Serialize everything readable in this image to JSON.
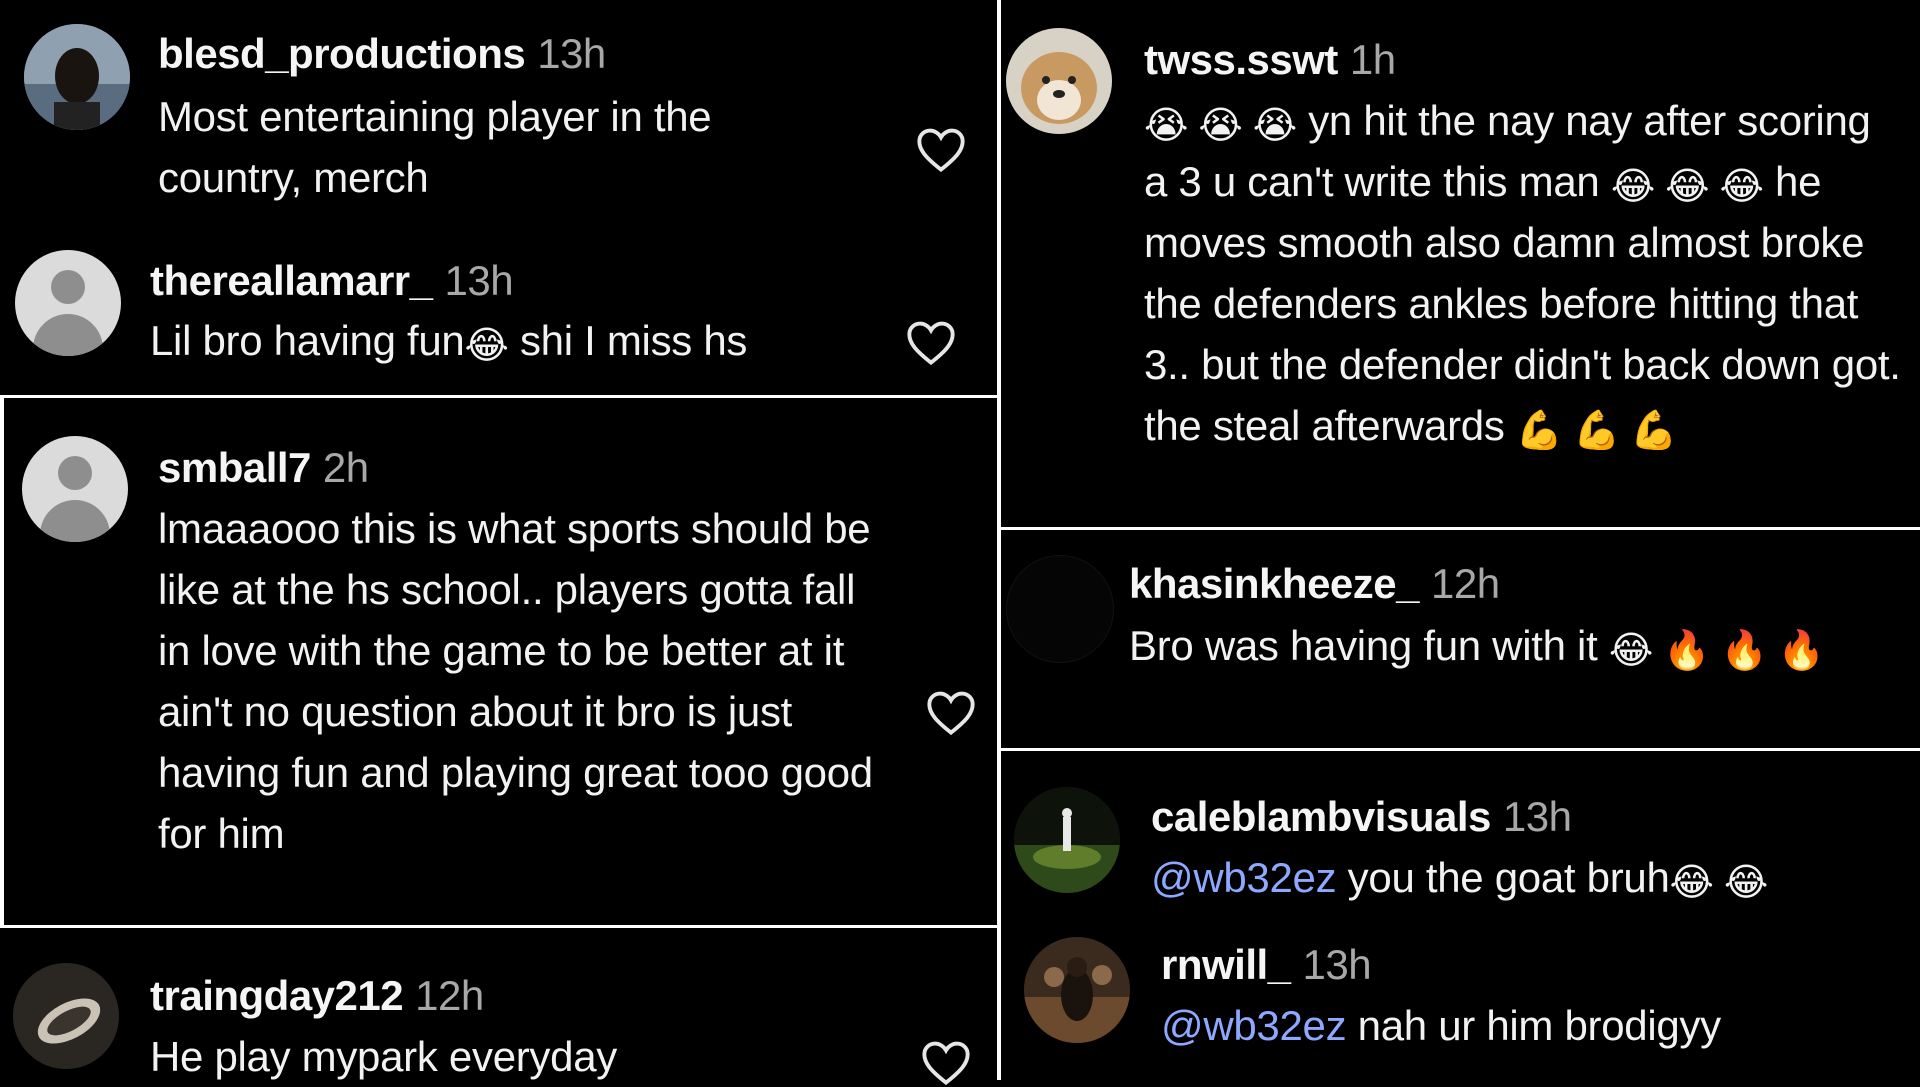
{
  "comments": [
    {
      "user": "blesd_productions",
      "time": "13h",
      "text": "Most entertaining player in the country, merch",
      "avatar": "photo-avatar-dark-portrait"
    },
    {
      "user": "thereallamarr_",
      "time": "13h",
      "text_before": "Lil bro having fun",
      "text_after": " shi I miss hs",
      "emoji": "😂",
      "avatar": "default-avatar"
    },
    {
      "user": "smball7",
      "time": "2h",
      "text": "lmaaaooo this is what sports should be like at the hs school.. players gotta fall in love with the game to be better at it ain't no question about it bro is just having fun and playing great tooo good for him",
      "avatar": "default-avatar"
    },
    {
      "user": "traingday212",
      "time": "12h",
      "text": "He play mypark everyday",
      "avatar": "photo-avatar-hand"
    },
    {
      "user": "twss.sswt",
      "time": "1h",
      "emoji_a": "😭 😭 😭",
      "text_a": " yn hit the nay nay after scoring a 3 u can't write this man ",
      "emoji_b": "😂 😂 😂",
      "text_b": " he moves smooth also damn almost broke the defenders ankles before hitting that 3.. but the defender didn't back down got. the steal afterwards ",
      "emoji_c": "💪 💪 💪",
      "avatar": "photo-avatar-dog"
    },
    {
      "user": "khasinkheeze_",
      "time": "12h",
      "text": "Bro was having fun with it ",
      "emoji": "😂 🔥 🔥 🔥",
      "avatar": "dark-avatar"
    },
    {
      "user": "caleblambvisuals",
      "time": "13h",
      "mention": "@wb32ez",
      "text": " you the goat bruh",
      "emoji": "😂 😂",
      "avatar": "photo-avatar-field"
    },
    {
      "user": "rnwill_",
      "time": "13h",
      "mention": "@wb32ez",
      "text": " nah ur him brodigyy",
      "avatar": "photo-avatar-crowd"
    }
  ],
  "colors": {
    "background": "#000000",
    "text": "#f2f2f2",
    "muted": "#a8a8a8",
    "mention": "#8fa8ff"
  },
  "icons": {
    "like": "heart-outline-icon"
  }
}
